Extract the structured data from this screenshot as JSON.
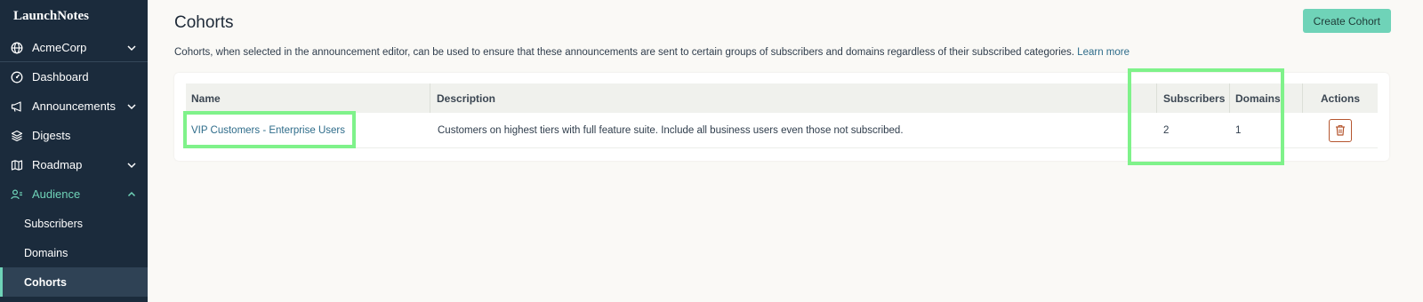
{
  "sidebar": {
    "logo": "LaunchNotes",
    "org": {
      "label": "AcmeCorp",
      "icon": "globe-icon"
    },
    "items": [
      {
        "label": "Dashboard",
        "icon": "dashboard-icon"
      },
      {
        "label": "Announcements",
        "icon": "megaphone-icon"
      },
      {
        "label": "Digests",
        "icon": "layers-icon"
      },
      {
        "label": "Roadmap",
        "icon": "map-icon"
      },
      {
        "label": "Audience",
        "icon": "users-icon"
      }
    ],
    "subitems": [
      {
        "label": "Subscribers"
      },
      {
        "label": "Domains"
      },
      {
        "label": "Cohorts"
      }
    ]
  },
  "header": {
    "title": "Cohorts",
    "create_label": "Create Cohort"
  },
  "description": {
    "text": "Cohorts, when selected in the announcement editor, can be used to ensure that these announcements are sent to certain groups of subscribers and domains regardless of their subscribed categories.",
    "link": "Learn more"
  },
  "table": {
    "headers": {
      "name": "Name",
      "description": "Description",
      "subscribers": "Subscribers",
      "domains": "Domains",
      "actions": "Actions"
    },
    "rows": [
      {
        "name": "VIP Customers - Enterprise Users",
        "description": "Customers on highest tiers with full feature suite. Include all business users even those not subscribed.",
        "subscribers": "2",
        "domains": "1"
      }
    ]
  },
  "colors": {
    "sidebar_bg": "#1b2b3c",
    "accent": "#6fd3b8",
    "link": "#2e6c8a",
    "delete": "#b5562f",
    "highlight": "#7ff28a"
  }
}
